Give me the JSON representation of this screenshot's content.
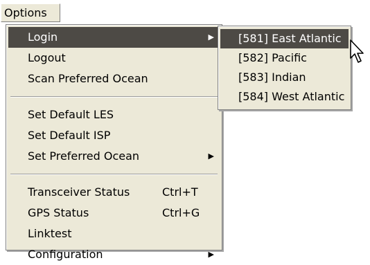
{
  "menubar": {
    "options_label": "Options"
  },
  "main_menu": {
    "items": [
      {
        "label": "Login",
        "has_submenu": true,
        "highlighted": true
      },
      {
        "label": "Logout"
      },
      {
        "label": "Scan Preferred Ocean"
      },
      {
        "label": "Set Default LES"
      },
      {
        "label": "Set Default ISP"
      },
      {
        "label": "Set Preferred Ocean",
        "has_submenu": true
      },
      {
        "label": "Transceiver Status",
        "shortcut": "Ctrl+T"
      },
      {
        "label": "GPS Status",
        "shortcut": "Ctrl+G"
      },
      {
        "label": "Linktest"
      },
      {
        "label": "Configuration",
        "has_submenu": true
      }
    ]
  },
  "login_submenu": {
    "items": [
      {
        "label": "[581] East Atlantic",
        "highlighted": true
      },
      {
        "label": "[582] Pacific"
      },
      {
        "label": "[583] Indian"
      },
      {
        "label": "[584] West Atlantic"
      }
    ]
  },
  "icons": {
    "submenu_arrow": "triangle-right-icon",
    "mouse_pointer": "arrow-cursor-icon"
  },
  "colors": {
    "menu_bg": "#ece9d8",
    "highlight_bg": "#4d4a45",
    "highlight_text": "#ffffff"
  }
}
